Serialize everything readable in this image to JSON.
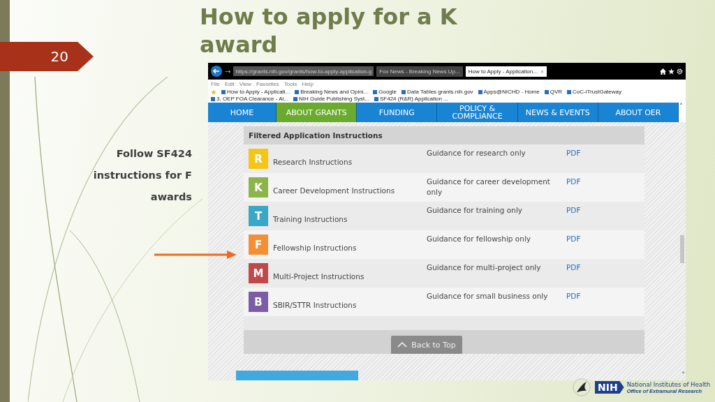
{
  "slide": {
    "title": "How to apply for a K award",
    "number": "20",
    "caption": "Follow SF424 instructions for F awards"
  },
  "browser": {
    "address": "https://grants.nih.gov/grants/how-to-apply-application-g",
    "tabs": [
      {
        "label": "Fox News - Breaking News Up...",
        "selected": false
      },
      {
        "label": "How to Apply - Application...",
        "selected": true
      }
    ],
    "close": "×",
    "forward": "→",
    "scroll_up": "˄",
    "scroll_down": "˅",
    "menu": [
      "File",
      "Edit",
      "View",
      "Favorites",
      "Tools",
      "Help"
    ],
    "favorites": [
      "How to Apply - Applicati...",
      "Breaking News and Opini...",
      "Google",
      "Data Tables  grants.nih.gov",
      "Apps@NICHD - Home",
      "QVR",
      "CoC-iTrustGateway",
      "3. OEP FOA Clearance - Al...",
      "NIH Guide Publishing Syst...",
      "SF424 (R&R) Application ..."
    ]
  },
  "nav": [
    {
      "label": "HOME",
      "selected": false
    },
    {
      "label": "ABOUT GRANTS",
      "selected": true
    },
    {
      "label": "FUNDING",
      "selected": false
    },
    {
      "label": "POLICY & COMPLIANCE",
      "selected": false
    },
    {
      "label": "NEWS & EVENTS",
      "selected": false
    },
    {
      "label": "ABOUT OER",
      "selected": false
    }
  ],
  "table": {
    "title": "Filtered Application Instructions",
    "rows": [
      {
        "letter": "R",
        "color": "#f5c518",
        "name": "Research Instructions",
        "guidance": "Guidance for research only",
        "link": "PDF"
      },
      {
        "letter": "K",
        "color": "#8bb54a",
        "name": "Career Development Instructions",
        "guidance": "Guidance for career development only",
        "link": "PDF"
      },
      {
        "letter": "T",
        "color": "#3aa6c8",
        "name": "Training Instructions",
        "guidance": "Guidance for training only",
        "link": "PDF"
      },
      {
        "letter": "F",
        "color": "#f39035",
        "name": "Fellowship Instructions",
        "guidance": "Guidance for fellowship only",
        "link": "PDF"
      },
      {
        "letter": "M",
        "color": "#c0474a",
        "name": "Multi-Project Instructions",
        "guidance": "Guidance for multi-project only",
        "link": "PDF"
      },
      {
        "letter": "B",
        "color": "#7a5da5",
        "name": "SBIR/STTR Instructions",
        "guidance": "Guidance for small business only",
        "link": "PDF"
      }
    ]
  },
  "back_to_top": "Back to Top",
  "logo": {
    "badge": "NIH",
    "name": "National Institutes of Health",
    "office": "Office of Extramural Research"
  }
}
